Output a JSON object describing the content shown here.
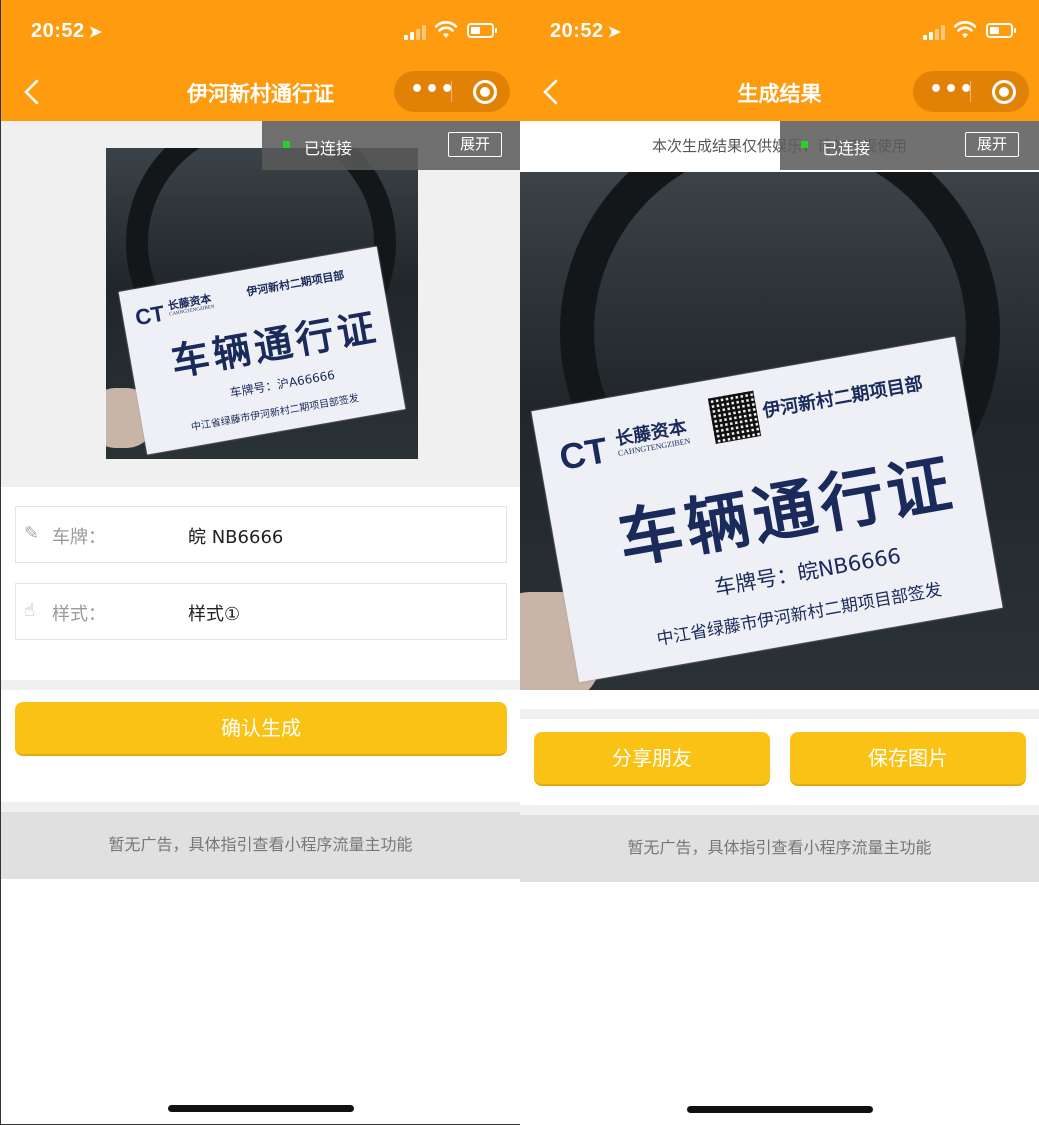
{
  "status_bar": {
    "time": "20:52",
    "location_arrow": "location-arrow-icon"
  },
  "connection": {
    "status": "已连接",
    "expand": "展开"
  },
  "left_screen": {
    "title": "伊河新村通行证",
    "card": {
      "logo": "CT",
      "brand": "长藤资本",
      "brand_en": "CAHNGTENGZIBEN",
      "dept": "伊河新村二期项目部",
      "headline": "车辆通行证",
      "plate": "车牌号：沪A66666",
      "issuer": "中江省绿藤市伊河新村二期项目部签发"
    },
    "form": {
      "plate_label": "车牌：",
      "plate_value": "皖 NB6666",
      "style_label": "样式：",
      "style_value": "样式①"
    },
    "confirm_button": "确认生成",
    "ad_text": "暂无广告，具体指引查看小程序流量主功能"
  },
  "right_screen": {
    "title": "生成结果",
    "notice": "本次生成结果仅供娱乐，请勿违规使用",
    "card": {
      "logo": "CT",
      "brand": "长藤资本",
      "brand_en": "CAHNGTENGZIBEN",
      "dept": "伊河新村二期项目部",
      "headline": "车辆通行证",
      "plate": "车牌号：皖NB6666",
      "issuer": "中江省绿藤市伊河新村二期项目部签发"
    },
    "share_button": "分享朋友",
    "save_button": "保存图片",
    "ad_text": "暂无广告，具体指引查看小程序流量主功能"
  },
  "colors": {
    "nav_orange": "#ff9b0f",
    "button_yellow": "#fac214",
    "connected_green": "#28d128"
  }
}
